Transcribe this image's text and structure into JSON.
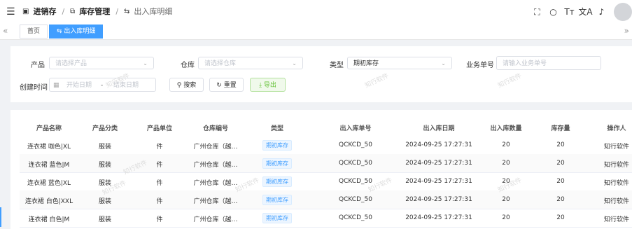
{
  "header": {
    "menu_icon": "hamburger-icon",
    "crumbs": [
      "进销存",
      "库存管理",
      "出入库明细"
    ],
    "tools": [
      "fullscreen-icon",
      "search-icon",
      "font-size-icon",
      "translate-icon",
      "bell-icon"
    ]
  },
  "tabs": {
    "home": "首页",
    "active": "出入库明细"
  },
  "filters": {
    "product": {
      "label": "产品",
      "placeholder": "请选择产品"
    },
    "warehouse": {
      "label": "仓库",
      "placeholder": "请选择仓库"
    },
    "type": {
      "label": "类型",
      "value": "期初库存"
    },
    "order_no": {
      "label": "业务单号",
      "placeholder": "请输入业务单号"
    },
    "created": {
      "label": "创建时间",
      "start_placeholder": "开始日期",
      "separator": "-",
      "end_placeholder": "结束日期"
    }
  },
  "buttons": {
    "search": "搜索",
    "reset": "重置",
    "export": "导出"
  },
  "table": {
    "headers": [
      "产品名称",
      "产品分类",
      "产品单位",
      "仓库编号",
      "类型",
      "出入库单号",
      "出入库日期",
      "出入库数量",
      "库存量",
      "操作人"
    ],
    "rows": [
      [
        "连衣裙 咖色|XL",
        "服装",
        "件",
        "广州仓库（越…",
        "期初库存",
        "QCKCD_50",
        "2024-09-25 17:27:31",
        "20",
        "20",
        "知行软件"
      ],
      [
        "连衣裙 蓝色|M",
        "服装",
        "件",
        "广州仓库（越…",
        "期初库存",
        "QCKCD_50",
        "2024-09-25 17:27:31",
        "20",
        "20",
        "知行软件"
      ],
      [
        "连衣裙 蓝色|XL",
        "服装",
        "件",
        "广州仓库（越…",
        "期初库存",
        "QCKCD_50",
        "2024-09-25 17:27:31",
        "20",
        "20",
        "知行软件"
      ],
      [
        "连衣裙 白色|XXL",
        "服装",
        "件",
        "广州仓库（越…",
        "期初库存",
        "QCKCD_50",
        "2024-09-25 17:27:31",
        "20",
        "20",
        "知行软件"
      ],
      [
        "连衣裙 白色|M",
        "服装",
        "件",
        "广州仓库（越…",
        "期初库存",
        "QCKCD_50",
        "2024-09-25 17:27:31",
        "20",
        "20",
        "知行软件"
      ]
    ]
  },
  "watermark": "知行软件",
  "colors": {
    "accent": "#409eff",
    "export_green": "#67c23a"
  }
}
